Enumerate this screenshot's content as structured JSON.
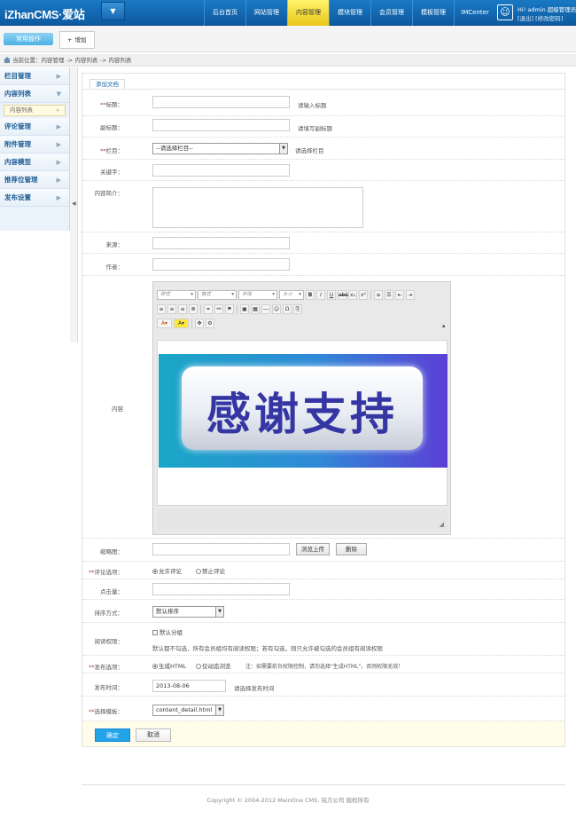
{
  "header": {
    "logo": "iZhanCMS·爱站",
    "nav": [
      "后台首页",
      "网站管理",
      "内容管理",
      "模块管理",
      "会员管理",
      "模板管理",
      "IMCenter"
    ],
    "active_nav": 2,
    "user_line1": "Hi! admin 超级管理员",
    "user_line2": "[退出] [修改密码]"
  },
  "tabs": {
    "common_label": "常用操作",
    "add_label": "增加"
  },
  "breadcrumb": "当前位置：内容管理 -> 内容列表 -> 内容列表",
  "sidebar": {
    "items": [
      {
        "label": "栏目管理"
      },
      {
        "label": "内容列表"
      },
      {
        "label": "评论管理"
      },
      {
        "label": "附件管理"
      },
      {
        "label": "内容模型"
      },
      {
        "label": "推荐位管理"
      },
      {
        "label": "发布设置"
      }
    ],
    "sub_item": "内容列表"
  },
  "form": {
    "tab_label": "添加文档",
    "title_label": "*标题：",
    "title_hint": "请输入标题",
    "subtitle_label": "副标题：",
    "subtitle_hint": "请填写副标题",
    "column_label": "*栏目：",
    "column_value": "--请选择栏目--",
    "column_hint": "请选择栏目",
    "keywords_label": "关键字：",
    "summary_label": "内容简介：",
    "source_label": "来源：",
    "author_label": "作者：",
    "content_label": "内容",
    "editor": {
      "combo_style": "样式",
      "combo_format": "格式",
      "combo_font": "字体",
      "combo_size": "大小",
      "image_text": "感谢支持"
    },
    "thumb_label": "缩略图：",
    "upload_btn": "浏览上传",
    "delete_btn": "删除",
    "comment_label": "*评论选项：",
    "comment_allow": "允许评论",
    "comment_forbid": "禁止评论",
    "hits_label": "点击量：",
    "sort_label": "排序方式：",
    "sort_value": "默认排序",
    "perm_label": "阅读权限：",
    "perm_check": "默认分组",
    "perm_note": "默认都不勾选，所有会员组均有阅读权限；若有勾选，则只允许被勾选的会员组有阅读权限",
    "publish_label": "*发布选项：",
    "publish_static": "生成HTML",
    "publish_dynamic": "仅动态浏览",
    "publish_note": "注：如需要前台权限控制，请勿选择\"生成HTML\"，否则权限无效！",
    "time_label": "发布时间：",
    "time_value": "2013-08-06",
    "time_hint": "请选择发布时间",
    "template_label": "*选择模板：",
    "template_value": "content_detail.html",
    "ok_btn": "确定",
    "cancel_btn": "取消"
  },
  "footer": "Copyright © 2004-2012 MainOne CMS. 铭万公司 版权所有"
}
